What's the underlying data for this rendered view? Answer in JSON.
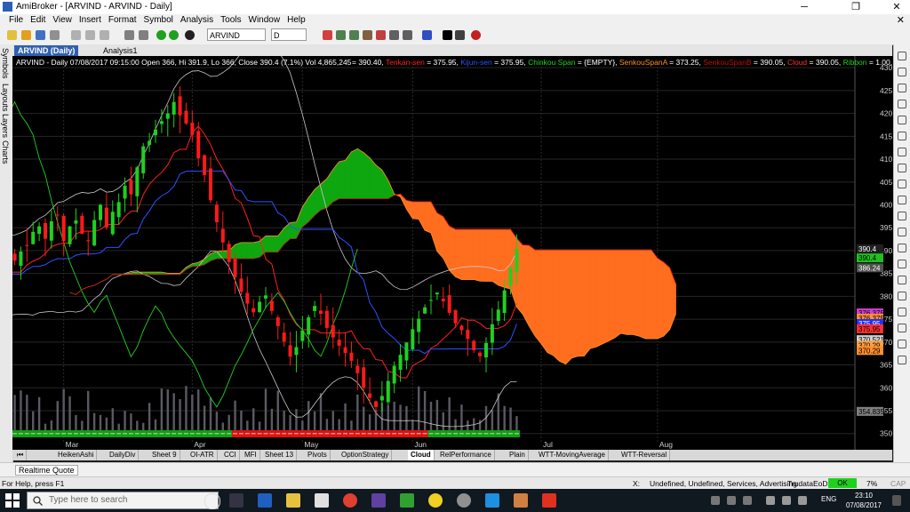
{
  "window": {
    "title": "AmiBroker - [ARVIND - ARVIND - Daily]",
    "minimize": "─",
    "restore": "❐",
    "close": "✕"
  },
  "menu": [
    "File",
    "Edit",
    "View",
    "Insert",
    "Format",
    "Symbol",
    "Analysis",
    "Tools",
    "Window",
    "Help"
  ],
  "menu_close": "✕",
  "toolbar": {
    "symbol": "ARVIND",
    "interval": "D"
  },
  "sidebar_tabs": [
    "Symbols",
    "Layouts",
    "Layers",
    "Charts"
  ],
  "doc_tabs": [
    {
      "label": "ARVIND (Daily)",
      "active": true
    },
    {
      "label": "Analysis1",
      "active": false
    }
  ],
  "chart_header": {
    "main": "ARVIND - Daily 07/08/2017 09:15:00 Open 366, Hi 391.9, Lo 366, Close 390.4 (7.1%) Vol 4,865,245",
    "items": [
      {
        "text": "= 390.40,",
        "color": "#ffffff"
      },
      {
        "text": "Tenkan-sen",
        "color": "#ff2020"
      },
      {
        "text": "= 375.95,",
        "color": "#ffffff"
      },
      {
        "text": "Kijun-sen",
        "color": "#3050ff"
      },
      {
        "text": "= 375.95,",
        "color": "#ffffff"
      },
      {
        "text": "Chinkou Span",
        "color": "#20d020"
      },
      {
        "text": "= {EMPTY},",
        "color": "#ffffff"
      },
      {
        "text": "SenkouSpanA",
        "color": "#ff9020"
      },
      {
        "text": "= 373.25,",
        "color": "#ffffff"
      },
      {
        "text": "SenkouSpanB",
        "color": "#c01010"
      },
      {
        "text": "= 390.05,",
        "color": "#ffffff"
      },
      {
        "text": "Cloud",
        "color": "#ff3030"
      },
      {
        "text": "= 390.05,",
        "color": "#ffffff"
      },
      {
        "text": "Ribbon",
        "color": "#20d020"
      },
      {
        "text": "= 1.00,",
        "color": "#ffffff"
      },
      {
        "text": "Rib",
        "color": "#ff2020"
      }
    ]
  },
  "price_tags": [
    {
      "label": "390.4",
      "value": 390.4,
      "bg": "#202020",
      "fg": "#ffffff"
    },
    {
      "label": "390.4",
      "value": 388.4,
      "bg": "#20c020",
      "fg": "#000000"
    },
    {
      "label": "386.24",
      "value": 386.24,
      "bg": "#505050",
      "fg": "#ffffff"
    },
    {
      "label": "376.375",
      "value": 376.375,
      "bg": "#d040d0",
      "fg": "#000000"
    },
    {
      "label": "376.375",
      "value": 375.2,
      "bg": "#ff9030",
      "fg": "#000000"
    },
    {
      "label": "375.95",
      "value": 374.05,
      "bg": "#2030ff",
      "fg": "#ffffff"
    },
    {
      "label": "375.95",
      "value": 372.9,
      "bg": "#ff3030",
      "fg": "#000000"
    },
    {
      "label": "370.521",
      "value": 370.521,
      "bg": "#d0d0d0",
      "fg": "#000000"
    },
    {
      "label": "370.29",
      "value": 369.3,
      "bg": "#ffa040",
      "fg": "#000000"
    },
    {
      "label": "370.29",
      "value": 368.15,
      "bg": "#ff9030",
      "fg": "#000000"
    },
    {
      "label": "354.835",
      "value": 354.835,
      "bg": "#808080",
      "fg": "#000000"
    }
  ],
  "chart_data": {
    "type": "candlestick",
    "symbol": "ARVIND",
    "interval": "Daily",
    "ylim": [
      348,
      431
    ],
    "yticks": [
      350,
      355,
      360,
      365,
      370,
      375,
      380,
      385,
      390,
      395,
      400,
      405,
      410,
      415,
      420,
      425,
      430
    ],
    "ytick_labels": [
      "350",
      "355",
      "360",
      "365",
      "370",
      "375",
      "380",
      "385",
      "390.4",
      "395",
      "400",
      "405",
      "410",
      "415",
      "420",
      "425",
      "430"
    ],
    "month_labels": [
      {
        "label": "Mar",
        "index": 7
      },
      {
        "label": "Apr",
        "index": 28
      },
      {
        "label": "May",
        "index": 46
      },
      {
        "label": "Jun",
        "index": 64
      },
      {
        "label": "Jul",
        "index": 85
      },
      {
        "label": "Aug",
        "index": 104
      }
    ],
    "bars_total": 108,
    "future_bars": 26,
    "close": [
      382.0,
      378.8,
      383.9,
      382.2,
      385.3,
      388.8,
      385.3,
      391.1,
      386.6,
      381.1,
      381.1,
      382.4,
      380.7,
      384.5,
      387.5,
      386.4,
      389.5,
      387.8,
      389.8,
      391.0,
      394.1,
      395.3,
      392.6,
      396.4,
      397.7,
      392.1,
      395.3,
      396.6,
      393.7,
      392.2,
      396.7,
      400.0,
      395.1,
      398.5,
      400.6,
      404.2,
      402.3,
      408.2,
      412.8,
      414.0,
      416.5,
      418.3,
      420.0,
      422.5,
      419.6,
      417.8,
      415.3,
      410.2,
      406.5,
      401.0,
      396.2,
      391.8,
      387.5,
      384.2,
      381.0,
      378.4,
      376.5,
      378.8,
      380.2,
      376.8,
      373.5,
      370.1,
      366.8,
      368.9,
      372.5,
      375.4,
      377.9,
      376.2,
      373.1,
      371.0,
      369.2,
      367.6,
      365.9,
      363.2,
      360.0,
      357.8,
      355.8,
      358.2,
      361.5,
      364.8,
      367.2,
      369.9,
      372.8,
      375.1,
      377.6,
      379.2,
      380.8,
      378.9,
      376.4,
      374.1,
      372.6,
      370.7,
      368.2,
      366.9,
      369.8,
      373.9,
      377.1,
      381.3,
      386.2,
      390.4
    ],
    "volume_scale": "relative",
    "series": [
      {
        "name": "Tenkan-sen",
        "color": "#ff2020"
      },
      {
        "name": "Kijun-sen",
        "color": "#3050ff"
      },
      {
        "name": "Chinkou Span",
        "color": "#20d020"
      },
      {
        "name": "SenkouSpanA",
        "color": "#ff9020"
      },
      {
        "name": "SenkouSpanB",
        "color": "#c01010"
      },
      {
        "name": "Cloud",
        "color": "#ff3030"
      },
      {
        "name": "Ribbon",
        "color": "#20d020"
      }
    ],
    "cloud_colors": {
      "bull": "#0fa70f",
      "bear": "#ff6d1f"
    }
  },
  "sheet_tabs": [
    "HeikenAshi",
    "DailyDiv",
    "Sheet 9",
    "OI-ATR",
    "CCI",
    "MFI",
    "Sheet 13",
    "Pivots",
    "OptionStrategy",
    "Cloud",
    "RelPerformance",
    "Plain",
    "WTT-MovingAverage",
    "WTT-Reversal"
  ],
  "active_sheet": "Cloud",
  "quote_tab": "Realtime Quote",
  "status": {
    "help": "For Help, press F1",
    "x": "X:",
    "info": "Undefined, Undefined, Services, Advertising",
    "source": "TrudataEoD",
    "ok": "OK",
    "pct": "7%",
    "cap": "CAP"
  },
  "taskbar": {
    "search_placeholder": "Type here to search",
    "lang": "ENG",
    "time": "23:10",
    "date": "07/08/2017"
  }
}
